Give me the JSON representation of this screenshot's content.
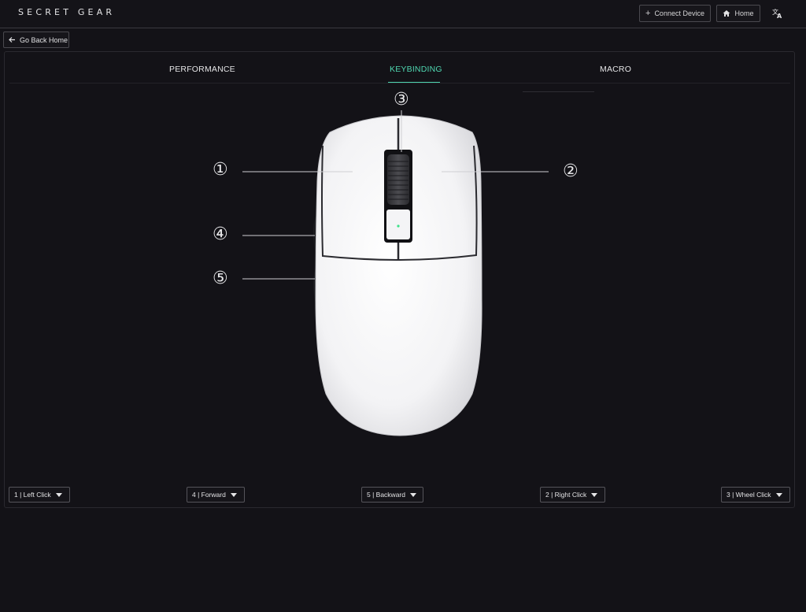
{
  "app": {
    "logo": "SECRET GEAR",
    "connect_label": "Connect Device",
    "home_label": "Home",
    "translate_icon": "translate-icon"
  },
  "nav": {
    "back_label": "Go Back Home"
  },
  "tabs": [
    {
      "label": "PERFORMANCE",
      "active": false
    },
    {
      "label": "KEYBINDING",
      "active": true
    },
    {
      "label": "MACRO",
      "active": false
    }
  ],
  "callouts": {
    "c1": "①",
    "c2": "②",
    "c3": "③",
    "c4": "④",
    "c5": "⑤"
  },
  "bindings": [
    {
      "label": "1 | Left Click"
    },
    {
      "label": "4 | Forward"
    },
    {
      "label": "5 | Backward"
    },
    {
      "label": "2 | Right Click"
    },
    {
      "label": "3 | Wheel Click"
    }
  ],
  "colors": {
    "accent": "#4fd6b0",
    "background": "#131217"
  }
}
